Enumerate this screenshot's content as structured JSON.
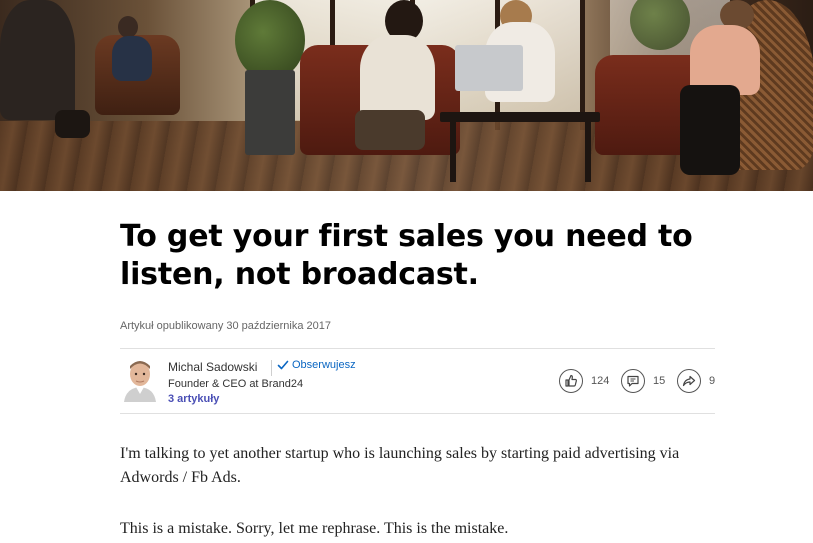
{
  "hero": {
    "image_description_icon": "office-lounge-photo-icon"
  },
  "article": {
    "title": "To get your first sales you need to listen, not broadcast.",
    "published": "Artykuł opublikowany 30 października 2017",
    "author": {
      "name": "Michal Sadowski",
      "follow_label": "Obserwujesz",
      "role": "Founder & CEO at Brand24",
      "articles": "3 artykuły"
    },
    "social": {
      "likes": "124",
      "comments": "15",
      "shares": "9"
    },
    "paragraphs": [
      "I'm talking to yet another startup who is launching sales by starting paid advertising via Adwords / Fb Ads.",
      "This is a mistake. Sorry, let me rephrase. This is the mistake."
    ]
  },
  "colors": {
    "link": "#0a66c2",
    "articles_link": "#4a4fb5",
    "muted_text": "#666666",
    "rule": "#e0e0e0"
  }
}
